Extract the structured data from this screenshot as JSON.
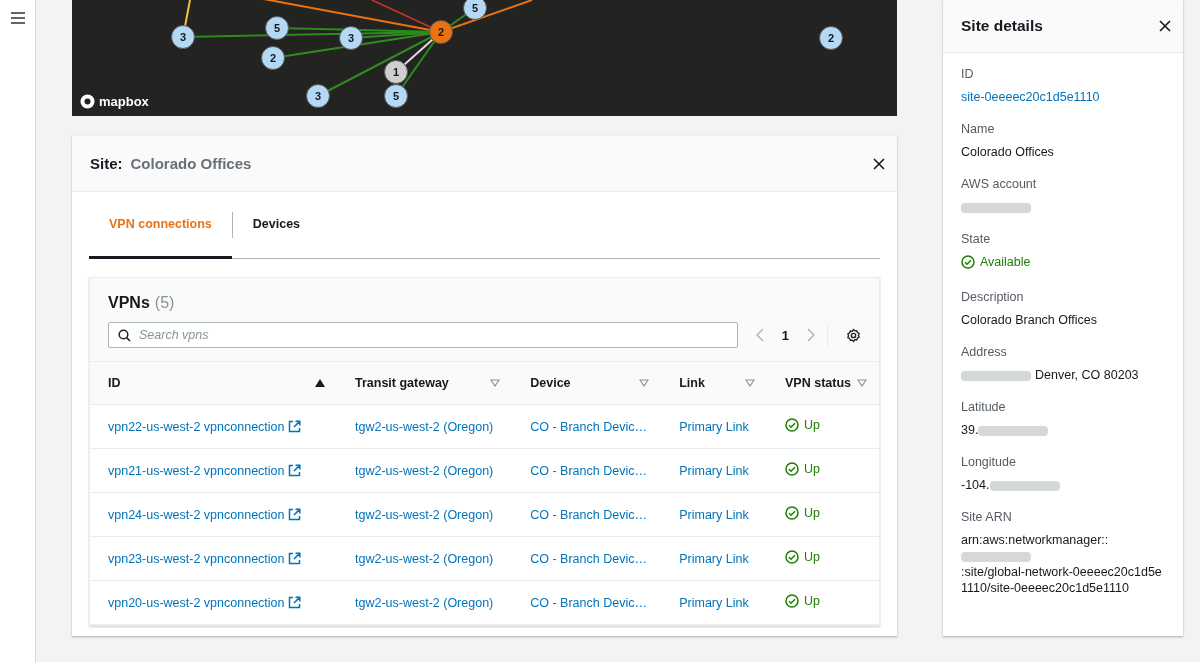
{
  "map": {
    "attribution": "mapbox",
    "markers": [
      {
        "count": "3",
        "color": "#b4d9f5"
      },
      {
        "count": "5",
        "color": "#b4d9f5"
      },
      {
        "count": "2",
        "color": "#b4d9f5"
      },
      {
        "count": "3",
        "color": "#b4d9f5"
      },
      {
        "count": "2",
        "color": "#ec7211"
      },
      {
        "count": "5",
        "color": "#b4d9f5"
      },
      {
        "count": "1",
        "color": "#cfcfcf"
      },
      {
        "count": "3",
        "color": "#b4d9f5"
      },
      {
        "count": "5",
        "color": "#b4d9f5"
      },
      {
        "count": "2",
        "color": "#b4d9f5"
      }
    ]
  },
  "site": {
    "label": "Site:",
    "name": "Colorado Offices",
    "tabs": [
      {
        "label": "VPN connections",
        "selected": true
      },
      {
        "label": "Devices",
        "selected": false
      }
    ],
    "vpns": {
      "title": "VPNs",
      "count": "(5)",
      "search": {
        "placeholder": "Search vpns"
      },
      "page": "1",
      "columns": [
        {
          "label": "ID",
          "sorted": true
        },
        {
          "label": "Transit gateway",
          "sorted": false
        },
        {
          "label": "Device",
          "sorted": false
        },
        {
          "label": "Link",
          "sorted": false
        },
        {
          "label": "VPN status",
          "sorted": false
        }
      ],
      "rows": [
        {
          "id": "vpn22-us-west-2 vpnconnection",
          "gateway": "tgw2-us-west-2 (Oregon)",
          "device": "CO - Branch Devic…",
          "link": "Primary Link",
          "status": "Up"
        },
        {
          "id": "vpn21-us-west-2 vpnconnection",
          "gateway": "tgw2-us-west-2 (Oregon)",
          "device": "CO - Branch Devic…",
          "link": "Primary Link",
          "status": "Up"
        },
        {
          "id": "vpn24-us-west-2 vpnconnection",
          "gateway": "tgw2-us-west-2 (Oregon)",
          "device": "CO - Branch Devic…",
          "link": "Primary Link",
          "status": "Up"
        },
        {
          "id": "vpn23-us-west-2 vpnconnection",
          "gateway": "tgw2-us-west-2 (Oregon)",
          "device": "CO - Branch Devic…",
          "link": "Primary Link",
          "status": "Up"
        },
        {
          "id": "vpn20-us-west-2 vpnconnection",
          "gateway": "tgw2-us-west-2 (Oregon)",
          "device": "CO - Branch Devic…",
          "link": "Primary Link",
          "status": "Up"
        }
      ]
    }
  },
  "details": {
    "title": "Site details",
    "fields": [
      {
        "label": "ID",
        "parts": [
          {
            "kind": "link",
            "text": "site-0eeeec20c1d5e1110"
          }
        ]
      },
      {
        "label": "Name",
        "parts": [
          {
            "kind": "text",
            "text": "Colorado Offices"
          }
        ]
      },
      {
        "label": "AWS account",
        "parts": [
          {
            "kind": "redacted"
          }
        ]
      },
      {
        "label": "State",
        "parts": [
          {
            "kind": "status",
            "text": "Available"
          }
        ]
      },
      {
        "label": "Description",
        "parts": [
          {
            "kind": "text",
            "text": "Colorado Branch Offices"
          }
        ]
      },
      {
        "label": "Address",
        "parts": [
          {
            "kind": "redacted"
          },
          {
            "kind": "text",
            "text": "Denver, CO 80203"
          }
        ]
      },
      {
        "label": "Latitude",
        "parts": [
          {
            "kind": "text",
            "text": "39."
          },
          {
            "kind": "redacted"
          }
        ]
      },
      {
        "label": "Longitude",
        "parts": [
          {
            "kind": "text",
            "text": "-104."
          },
          {
            "kind": "redacted"
          }
        ]
      },
      {
        "label": "Site ARN",
        "parts": [
          {
            "kind": "text",
            "text": "arn:aws:networkmanager::"
          },
          {
            "kind": "redacted"
          },
          {
            "kind": "text",
            "text": ":site/global-network-0eeeec20c1d5e1110/site-0eeeec20c1d5e1110"
          }
        ]
      }
    ]
  }
}
